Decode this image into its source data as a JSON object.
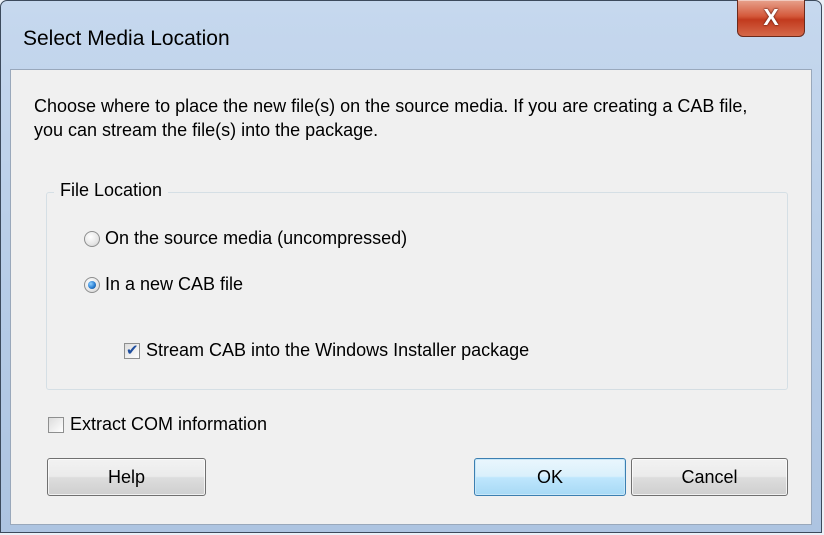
{
  "dialog": {
    "title": "Select Media Location",
    "close_glyph": "X",
    "description": "Choose where to place the new file(s) on the source media. If you are creating a CAB file, you can stream the file(s) into the package.",
    "group_label": "File Location",
    "options": {
      "source_media": {
        "label": "On the source media (uncompressed)",
        "checked": false
      },
      "new_cab": {
        "label": "In a new CAB file",
        "checked": true
      },
      "stream_cab": {
        "label": "Stream CAB into the Windows Installer package",
        "checked": true
      }
    },
    "extract_com": {
      "label": "Extract COM information",
      "checked": false
    },
    "buttons": {
      "help": "Help",
      "ok": "OK",
      "cancel": "Cancel"
    }
  },
  "colors": {
    "close_button": "#c23a1e",
    "default_button": "#3c7fb1",
    "radio_dot": "#2a7fd3",
    "checkmark": "#1f4e9e"
  }
}
